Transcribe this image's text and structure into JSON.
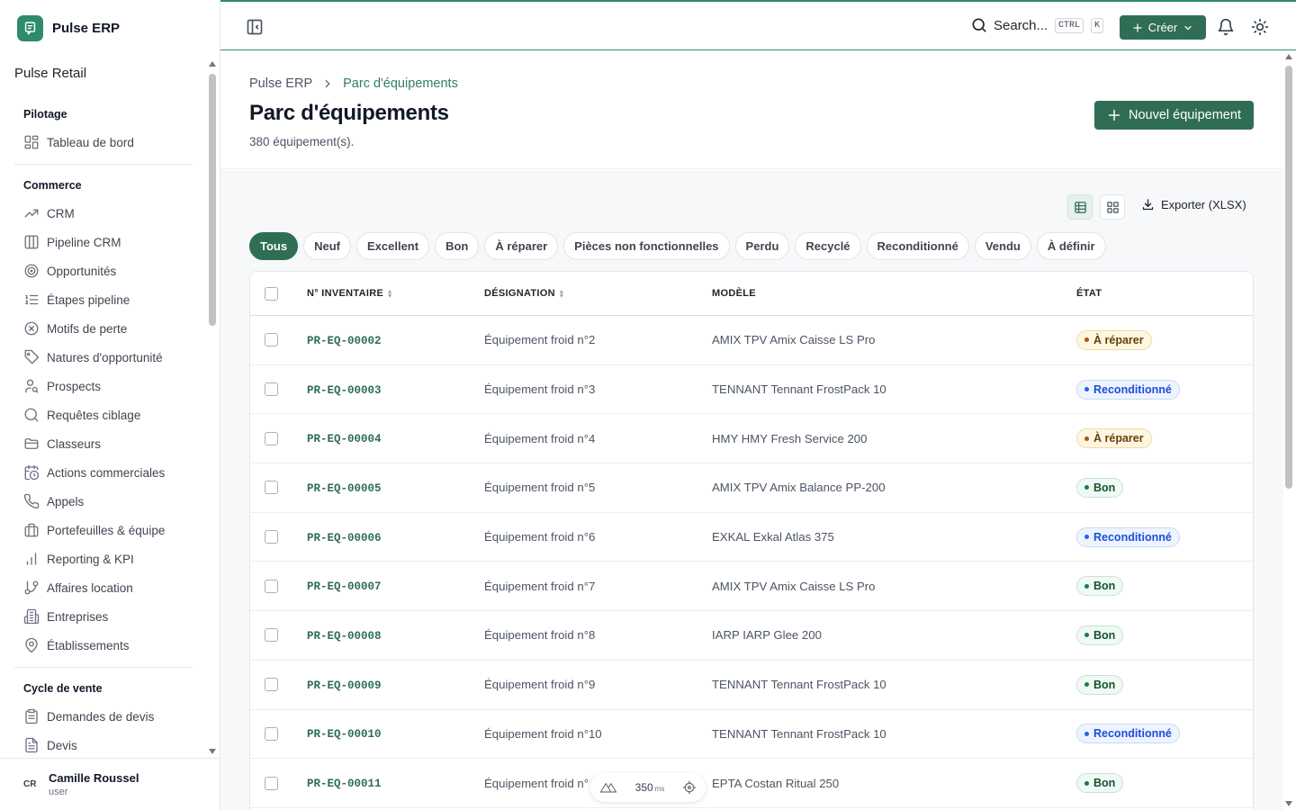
{
  "app": {
    "name": "Pulse ERP",
    "workspace": "Pulse Retail"
  },
  "sidebar": {
    "sections": [
      {
        "title": "Pilotage",
        "items": [
          {
            "label": "Tableau de bord",
            "icon": "dashboard-icon"
          }
        ]
      },
      {
        "title": "Commerce",
        "items": [
          {
            "label": "CRM",
            "icon": "trend-icon"
          },
          {
            "label": "Pipeline CRM",
            "icon": "columns-icon"
          },
          {
            "label": "Opportunités",
            "icon": "target-icon"
          },
          {
            "label": "Étapes pipeline",
            "icon": "list-ordered-icon"
          },
          {
            "label": "Motifs de perte",
            "icon": "x-circle-icon"
          },
          {
            "label": "Natures d'opportunité",
            "icon": "tag-icon"
          },
          {
            "label": "Prospects",
            "icon": "user-search-icon"
          },
          {
            "label": "Requêtes ciblage",
            "icon": "search-icon"
          },
          {
            "label": "Classeurs",
            "icon": "folder-icon"
          },
          {
            "label": "Actions commerciales",
            "icon": "calendar-clock-icon"
          },
          {
            "label": "Appels",
            "icon": "phone-icon"
          },
          {
            "label": "Portefeuilles & équipe",
            "icon": "briefcase-icon"
          },
          {
            "label": "Reporting & KPI",
            "icon": "bar-chart-icon"
          },
          {
            "label": "Affaires location",
            "icon": "git-branch-icon"
          },
          {
            "label": "Entreprises",
            "icon": "building-icon"
          },
          {
            "label": "Établissements",
            "icon": "map-pin-icon"
          }
        ]
      },
      {
        "title": "Cycle de vente",
        "items": [
          {
            "label": "Demandes de devis",
            "icon": "clipboard-icon"
          },
          {
            "label": "Devis",
            "icon": "file-text-icon"
          }
        ]
      }
    ],
    "user": {
      "initials": "CR",
      "name": "Camille Roussel",
      "role": "user"
    }
  },
  "topbar": {
    "search_label": "Search...",
    "shortcut_keys": [
      "CTRL",
      "K"
    ],
    "create_label": "Créer"
  },
  "breadcrumb": {
    "root": "Pulse ERP",
    "current": "Parc d'équipements"
  },
  "page": {
    "title": "Parc d'équipements",
    "count_text": "380 équipement(s).",
    "new_button": "Nouvel équipement",
    "export_label": "Exporter (XLSX)"
  },
  "filters": [
    {
      "label": "Tous",
      "active": true
    },
    {
      "label": "Neuf"
    },
    {
      "label": "Excellent"
    },
    {
      "label": "Bon"
    },
    {
      "label": "À réparer"
    },
    {
      "label": "Pièces non fonctionnelles"
    },
    {
      "label": "Perdu"
    },
    {
      "label": "Recyclé"
    },
    {
      "label": "Reconditionné"
    },
    {
      "label": "Vendu"
    },
    {
      "label": "À définir"
    }
  ],
  "table": {
    "columns": [
      "N° INVENTAIRE",
      "DÉSIGNATION",
      "MODÈLE",
      "ÉTAT"
    ],
    "rows": [
      {
        "inventory": "PR-EQ-00002",
        "designation": "Équipement froid n°2",
        "model": "AMIX TPV Amix Caisse LS Pro",
        "state": "À réparer",
        "kind": "repair"
      },
      {
        "inventory": "PR-EQ-00003",
        "designation": "Équipement froid n°3",
        "model": "TENNANT Tennant FrostPack 10",
        "state": "Reconditionné",
        "kind": "recon"
      },
      {
        "inventory": "PR-EQ-00004",
        "designation": "Équipement froid n°4",
        "model": "HMY HMY Fresh Service 200",
        "state": "À réparer",
        "kind": "repair"
      },
      {
        "inventory": "PR-EQ-00005",
        "designation": "Équipement froid n°5",
        "model": "AMIX TPV Amix Balance PP-200",
        "state": "Bon",
        "kind": "bon"
      },
      {
        "inventory": "PR-EQ-00006",
        "designation": "Équipement froid n°6",
        "model": "EXKAL Exkal Atlas 375",
        "state": "Reconditionné",
        "kind": "recon"
      },
      {
        "inventory": "PR-EQ-00007",
        "designation": "Équipement froid n°7",
        "model": "AMIX TPV Amix Caisse LS Pro",
        "state": "Bon",
        "kind": "bon"
      },
      {
        "inventory": "PR-EQ-00008",
        "designation": "Équipement froid n°8",
        "model": "IARP IARP Glee 200",
        "state": "Bon",
        "kind": "bon"
      },
      {
        "inventory": "PR-EQ-00009",
        "designation": "Équipement froid n°9",
        "model": "TENNANT Tennant FrostPack 10",
        "state": "Bon",
        "kind": "bon"
      },
      {
        "inventory": "PR-EQ-00010",
        "designation": "Équipement froid n°10",
        "model": "TENNANT Tennant FrostPack 10",
        "state": "Reconditionné",
        "kind": "recon"
      },
      {
        "inventory": "PR-EQ-00011",
        "designation": "Équipement froid n°",
        "model": "EPTA Costan Ritual 250",
        "state": "Bon",
        "kind": "bon"
      }
    ]
  },
  "devtools": {
    "value": "350",
    "unit": "ms"
  },
  "colors": {
    "brand": "#2f6e55",
    "accent": "#2f8a6e"
  }
}
